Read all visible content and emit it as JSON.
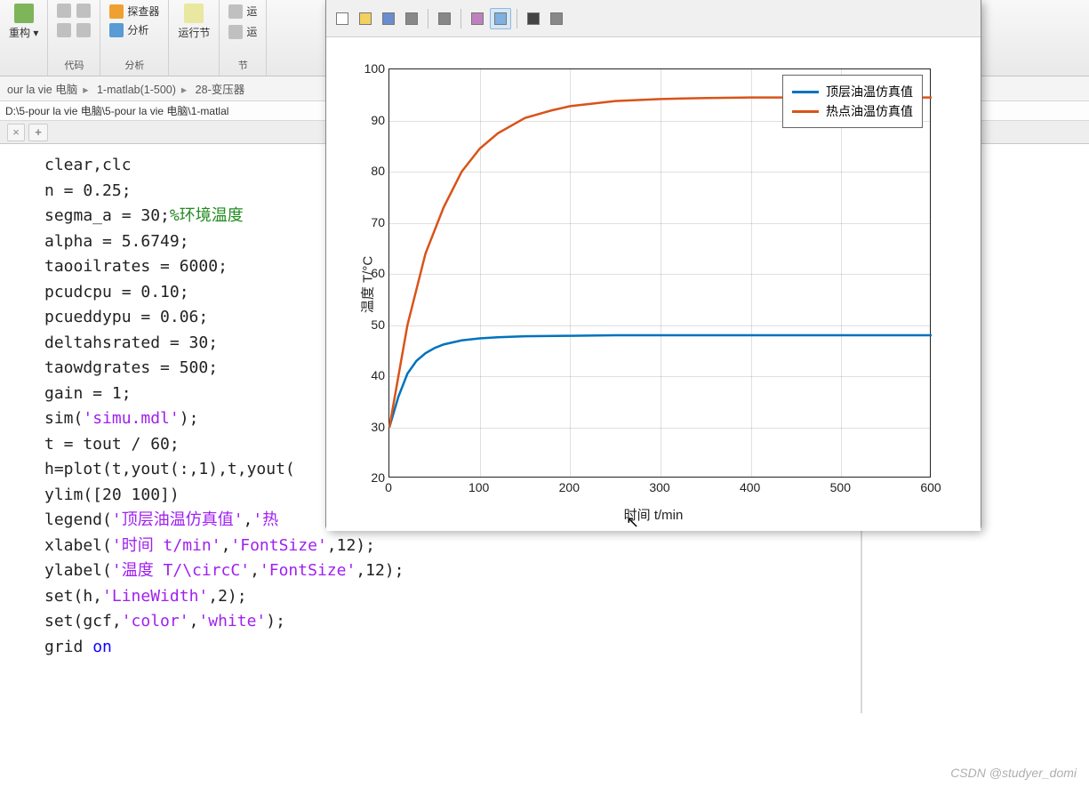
{
  "ribbon": {
    "groups": [
      {
        "label": "",
        "big": {
          "label": "重构",
          "arrow": "▾"
        }
      },
      {
        "label": "代码",
        "small_icons": 4
      },
      {
        "label": "分析",
        "items": [
          "探查器",
          "分析"
        ]
      },
      {
        "label": "",
        "big": {
          "label": "运行节"
        }
      },
      {
        "label": "节",
        "small_icons": 2
      }
    ]
  },
  "breadcrumb": {
    "parts": [
      "our la vie 电脑",
      "1-matlab(1-500)",
      "28-变压器"
    ]
  },
  "pathbar": {
    "text": "D:\\5-pour la vie 电脑\\5-pour la vie 电脑\\1-matlal"
  },
  "tabs": {
    "close": "×",
    "add": "+"
  },
  "code": {
    "lines": [
      {
        "t": "clear,clc",
        "kind": "plain"
      },
      {
        "t": "n = 0.25;",
        "kind": "plain"
      },
      {
        "pre": "segma_a = 30;",
        "cmt": "%环境温度"
      },
      {
        "t": "alpha = 5.6749;",
        "kind": "plain"
      },
      {
        "t": "taooilrates = 6000;",
        "kind": "plain"
      },
      {
        "t": "pcudcpu = 0.10;",
        "kind": "plain"
      },
      {
        "t": "pcueddypu = 0.06;",
        "kind": "plain"
      },
      {
        "t": "deltahsrated = 30;",
        "kind": "plain"
      },
      {
        "t": "taowdgrates = 500;",
        "kind": "plain"
      },
      {
        "t": "gain = 1;",
        "kind": "plain"
      },
      {
        "segs": [
          {
            "p": "sim("
          },
          {
            "s": "'simu.mdl'"
          },
          {
            "p": ");"
          }
        ]
      },
      {
        "t": "t = tout / 60;",
        "kind": "plain"
      },
      {
        "t": "h=plot(t,yout(:,1),t,yout(",
        "kind": "plain"
      },
      {
        "t": "ylim([20 100])",
        "kind": "plain"
      },
      {
        "segs": [
          {
            "p": "legend("
          },
          {
            "s": "'顶层油温仿真值'"
          },
          {
            "p": ","
          },
          {
            "s": "'热"
          }
        ]
      },
      {
        "segs": [
          {
            "p": "xlabel("
          },
          {
            "s": "'时间 t/min'"
          },
          {
            "p": ","
          },
          {
            "s": "'FontSize'"
          },
          {
            "p": ",12);"
          }
        ]
      },
      {
        "segs": [
          {
            "p": "ylabel("
          },
          {
            "s": "'温度 T/\\circC'"
          },
          {
            "p": ","
          },
          {
            "s": "'FontSize'"
          },
          {
            "p": ",12);"
          }
        ]
      },
      {
        "segs": [
          {
            "p": "set(h,"
          },
          {
            "s": "'LineWidth'"
          },
          {
            "p": ",2);"
          }
        ]
      },
      {
        "segs": [
          {
            "p": "set(gcf,"
          },
          {
            "s": "'color'"
          },
          {
            "p": ","
          },
          {
            "s": "'white'"
          },
          {
            "p": ");"
          }
        ]
      },
      {
        "segs": [
          {
            "p": "grid "
          },
          {
            "k": "on"
          }
        ]
      }
    ]
  },
  "figure": {
    "toolbar_icons": [
      "new",
      "open",
      "save",
      "print",
      "|",
      "copy",
      "|",
      "toggle1",
      "toggle2",
      "|",
      "pointer",
      "box"
    ],
    "active_tool_index": 8
  },
  "chart_data": {
    "type": "line",
    "xlabel": "时间 t/min",
    "ylabel": "温度 T/°C",
    "xlim": [
      0,
      600
    ],
    "ylim": [
      20,
      100
    ],
    "xticks": [
      0,
      100,
      200,
      300,
      400,
      500,
      600
    ],
    "yticks": [
      20,
      30,
      40,
      50,
      60,
      70,
      80,
      90,
      100
    ],
    "grid": true,
    "legend": {
      "position": "northeast"
    },
    "colors": {
      "series1": "#0072BD",
      "series2": "#D95319"
    },
    "series": [
      {
        "name": "顶层油温仿真值",
        "color": "#0072BD",
        "x": [
          0,
          10,
          20,
          30,
          40,
          50,
          60,
          80,
          100,
          120,
          150,
          200,
          250,
          300,
          400,
          500,
          600
        ],
        "y": [
          30,
          36,
          40.5,
          43,
          44.5,
          45.5,
          46.2,
          47,
          47.4,
          47.6,
          47.8,
          47.9,
          48,
          48,
          48,
          48,
          48
        ]
      },
      {
        "name": "热点油温仿真值",
        "color": "#D95319",
        "x": [
          0,
          20,
          40,
          60,
          80,
          100,
          120,
          150,
          180,
          200,
          250,
          300,
          350,
          400,
          500,
          600
        ],
        "y": [
          30,
          50,
          64,
          73,
          80,
          84.5,
          87.5,
          90.5,
          92,
          92.8,
          93.8,
          94.2,
          94.4,
          94.5,
          94.5,
          94.5
        ]
      }
    ]
  },
  "watermark": "CSDN @studyer_domi"
}
